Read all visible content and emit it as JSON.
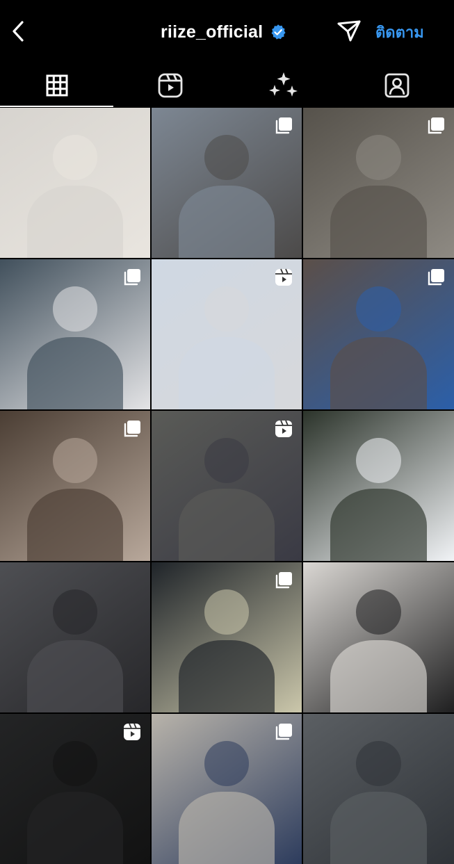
{
  "header": {
    "username": "riize_official",
    "follow_label": "ติดตาม",
    "verified": true
  },
  "icons": {
    "back": "chevron-left-icon",
    "verified": "verified-badge-icon",
    "send": "paper-plane-icon",
    "follow": "follow-button"
  },
  "tabs": [
    {
      "name": "posts",
      "icon": "grid-icon",
      "active": true
    },
    {
      "name": "reels",
      "icon": "reels-icon",
      "active": false
    },
    {
      "name": "effects",
      "icon": "sparkles-icon",
      "active": false
    },
    {
      "name": "tagged",
      "icon": "tagged-person-icon",
      "active": false
    }
  ],
  "grid": [
    {
      "badge": "none",
      "bg": "#d7d4cf",
      "fg": "#e9e5df"
    },
    {
      "badge": "carousel",
      "bg": "#7d8793",
      "fg": "#4c4a49"
    },
    {
      "badge": "carousel",
      "bg": "#56524b",
      "fg": "#8e8a83"
    },
    {
      "badge": "carousel",
      "bg": "#41505c",
      "fg": "#e4e4e6"
    },
    {
      "badge": "reels",
      "bg": "#cfd8e3",
      "fg": "#d7d8db"
    },
    {
      "badge": "carousel",
      "bg": "#5b4f49",
      "fg": "#2b5fa9"
    },
    {
      "badge": "carousel",
      "bg": "#4b3e34",
      "fg": "#b8a89b"
    },
    {
      "badge": "reels",
      "bg": "#5a5b57",
      "fg": "#3a3a44"
    },
    {
      "badge": "none",
      "bg": "#2c342b",
      "fg": "#f1f3f6"
    },
    {
      "badge": "none",
      "bg": "#4e4f53",
      "fg": "#27272a"
    },
    {
      "badge": "carousel",
      "bg": "#1f2429",
      "fg": "#cbc7ab"
    },
    {
      "badge": "none",
      "bg": "#dad7d3",
      "fg": "#1f1f20"
    },
    {
      "badge": "reels",
      "bg": "#232425",
      "fg": "#121212"
    },
    {
      "badge": "carousel",
      "bg": "#b8b3aa",
      "fg": "#2d3c5d"
    },
    {
      "badge": "none",
      "bg": "#5b5f63",
      "fg": "#2f3338"
    }
  ]
}
